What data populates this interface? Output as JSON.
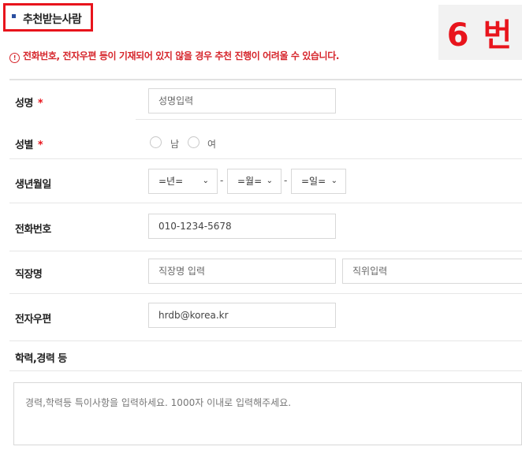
{
  "section": {
    "title": "추천받는사람"
  },
  "badge": {
    "text": "6 번"
  },
  "notice": {
    "icon": "warning-circle-icon",
    "text": "전화번호, 전자우편 등이 기재되어 있지 않을 경우 추천 진행이 어려울 수 있습니다."
  },
  "form": {
    "name": {
      "label": "성명",
      "required_mark": "*",
      "placeholder": "성명입력"
    },
    "gender": {
      "label": "성별",
      "required_mark": "*",
      "options": [
        "남",
        "여"
      ]
    },
    "birth": {
      "label": "생년월일",
      "year": "=년=",
      "month": "=월=",
      "day": "=일=",
      "separator": "-"
    },
    "phone": {
      "label": "전화번호",
      "value": "010-1234-5678"
    },
    "work": {
      "label": "직장명",
      "company_placeholder": "직장명 입력",
      "position_placeholder": "직위입력"
    },
    "email": {
      "label": "전자우편",
      "value": "hrdb@korea.kr"
    },
    "career": {
      "label": "학력,경력 등",
      "placeholder": "경력,학력등 특이사항을 입력하세요. 1000자 이내로 입력해주세요."
    }
  },
  "colors": {
    "accent_red": "#e8141c",
    "bullet_blue": "#2a4ea0"
  }
}
